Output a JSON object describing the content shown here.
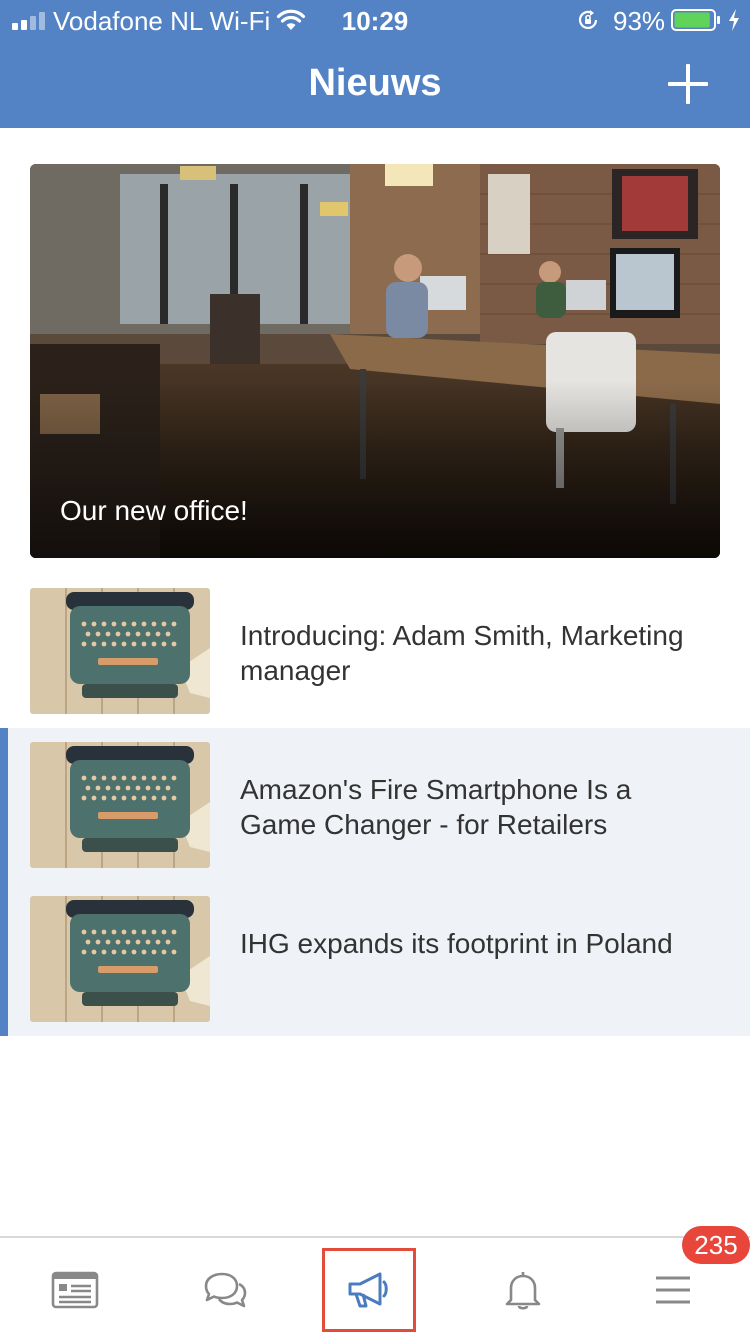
{
  "status_bar": {
    "carrier": "Vodafone NL Wi-Fi",
    "time": "10:29",
    "battery_percent": "93%",
    "battery_level": 0.93,
    "signal_bars_active": 2,
    "icons": [
      "signal-icon",
      "wifi-icon",
      "rotation-lock-icon",
      "battery-icon",
      "charging-bolt-icon"
    ]
  },
  "header": {
    "title": "Nieuws",
    "add_icon": "plus-icon"
  },
  "hero": {
    "caption": "Our new office!"
  },
  "news": [
    {
      "title": "Introducing: Adam Smith, Marketing manager",
      "highlighted": false
    },
    {
      "title": "Amazon's Fire Smartphone Is a Game Changer - for Retailers",
      "highlighted": true
    },
    {
      "title": "IHG expands its footprint in Poland",
      "highlighted": true
    }
  ],
  "tab_bar": {
    "tabs": [
      {
        "icon": "newspaper-icon"
      },
      {
        "icon": "chat-bubbles-icon"
      },
      {
        "icon": "megaphone-icon",
        "active": true
      },
      {
        "icon": "bell-icon"
      },
      {
        "icon": "menu-icon"
      }
    ],
    "badge": "235"
  },
  "colors": {
    "accent": "#5383c4",
    "badge": "#e8463a",
    "highlight_bg": "#eff2f6",
    "active_tab_border": "#e34b3b"
  }
}
